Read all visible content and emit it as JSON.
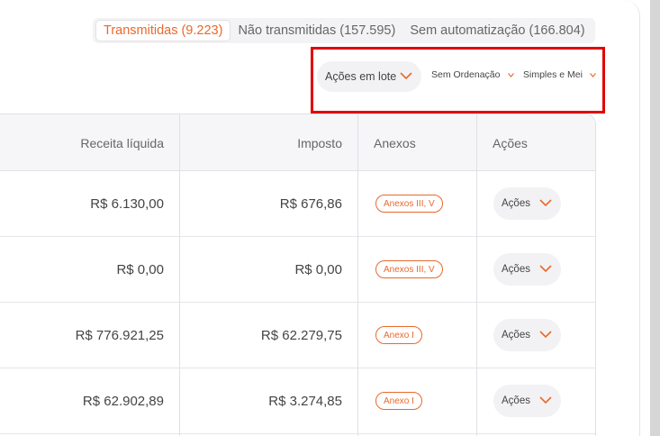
{
  "tabs": [
    {
      "label": "Transmitidas (9.223)",
      "active": true
    },
    {
      "label": "Não transmitidas (157.595)",
      "active": false
    },
    {
      "label": "Sem automatização (166.804)",
      "active": false
    }
  ],
  "toolbar": {
    "bulk_actions_label": "Ações em lote",
    "sort_label": "Sem Ordenação",
    "regime_label": "Simples e Mei"
  },
  "table": {
    "headers": {
      "revenue": "Receita líquida",
      "tax": "Imposto",
      "annexes": "Anexos",
      "actions": "Ações"
    },
    "rows": [
      {
        "revenue": "R$ 6.130,00",
        "tax": "R$ 676,86",
        "annex": "Anexos III, V",
        "action": "Ações"
      },
      {
        "revenue": "R$ 0,00",
        "tax": "R$ 0,00",
        "annex": "Anexos III, V",
        "action": "Ações"
      },
      {
        "revenue": "R$ 776.921,25",
        "tax": "R$ 62.279,75",
        "annex": "Anexo I",
        "action": "Ações"
      },
      {
        "revenue": "R$ 62.902,89",
        "tax": "R$ 3.274,85",
        "annex": "Anexo I",
        "action": "Ações"
      }
    ]
  },
  "colors": {
    "accent": "#e8692c",
    "highlight": "#e10000"
  },
  "icons": {
    "dropdown": "chevron-down-icon"
  }
}
